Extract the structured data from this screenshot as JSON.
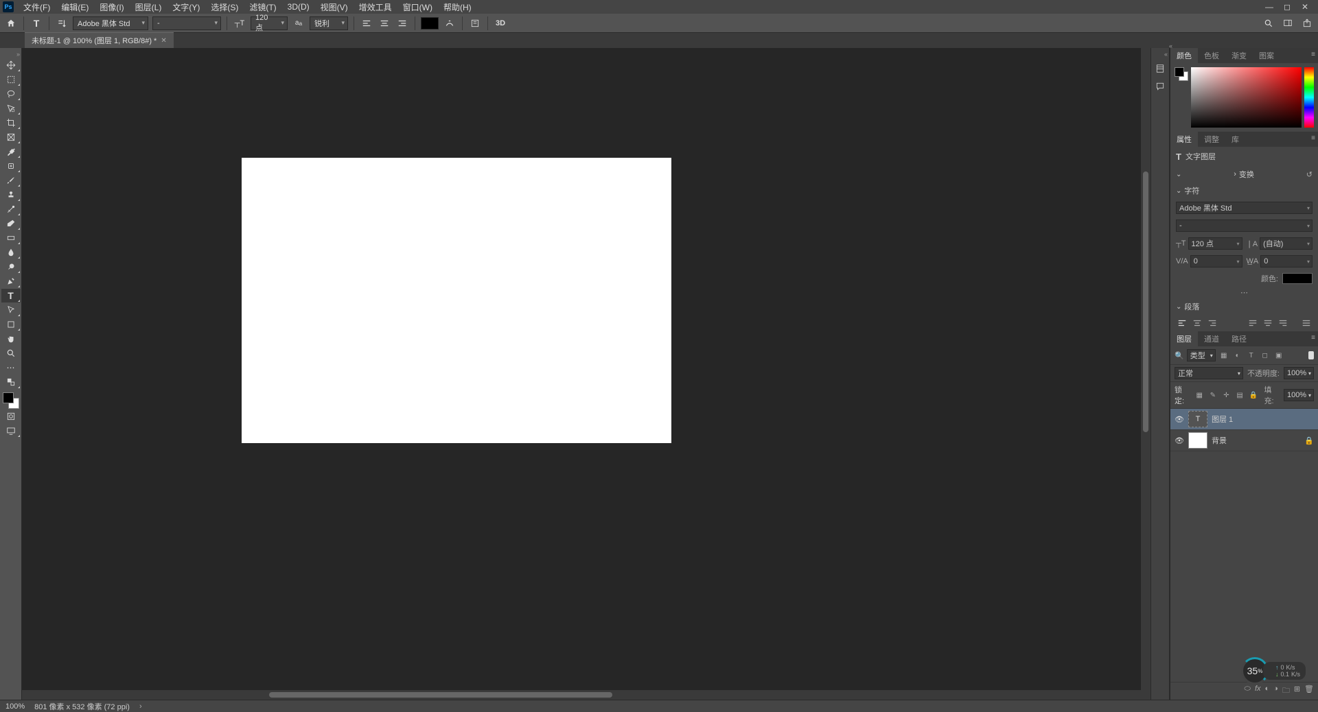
{
  "menu": {
    "items": [
      "文件(F)",
      "编辑(E)",
      "图像(I)",
      "图层(L)",
      "文字(Y)",
      "选择(S)",
      "滤镜(T)",
      "3D(D)",
      "视图(V)",
      "增效工具",
      "窗口(W)",
      "帮助(H)"
    ]
  },
  "optbar": {
    "font": "Adobe 黑体 Std",
    "style": "-",
    "size": "120 点",
    "aa": "锐利",
    "threeD": "3D"
  },
  "doc_tab": "未标题-1 @ 100% (图层 1, RGB/8#) *",
  "status": {
    "zoom": "100%",
    "dims": "801 像素 x 532 像素 (72 ppi)"
  },
  "panels": {
    "color_tabs": [
      "颜色",
      "色板",
      "渐变",
      "图案"
    ],
    "props_tabs": [
      "属性",
      "调整",
      "库"
    ],
    "layers_tabs": [
      "图层",
      "通道",
      "路径"
    ],
    "props": {
      "type_label": "文字图层",
      "transform": "变换",
      "char": "字符",
      "font": "Adobe 黑体 Std",
      "style": "-",
      "size": "120 点",
      "leading": "(自动)",
      "va": "0",
      "wa": "0",
      "color_label": "颜色:",
      "para": "段落"
    },
    "layers": {
      "filter_label": "类型",
      "blend": "正常",
      "opacity_label": "不透明度:",
      "opacity": "100%",
      "lock_label": "锁定:",
      "fill_label": "填充:",
      "fill": "100%",
      "items": [
        {
          "name": "图层 1",
          "type": "text"
        },
        {
          "name": "背景",
          "type": "raster",
          "locked": true
        }
      ]
    }
  },
  "net": {
    "pct": "35",
    "up": "0",
    "down": "0.1",
    "unit": "K/s"
  }
}
